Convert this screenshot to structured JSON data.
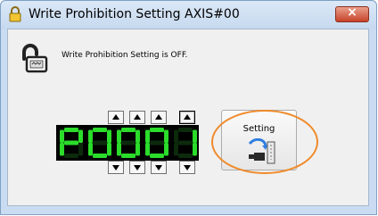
{
  "window": {
    "title": "Write Prohibition Setting AXIS#00",
    "close_label": "×"
  },
  "status": {
    "message": "Write Prohibition Setting is OFF."
  },
  "display": {
    "value": "P0001",
    "color": "#2bdc2b"
  },
  "setting_button": {
    "label": "Setting",
    "icon": "write-to-device-icon"
  },
  "icons": {
    "title": "padlock-icon",
    "status": "unlocked-padlock-icon"
  },
  "colors": {
    "highlight": "#ef8a2a",
    "segment_on": "#2bdc2b",
    "close_button": "#c7432a"
  }
}
